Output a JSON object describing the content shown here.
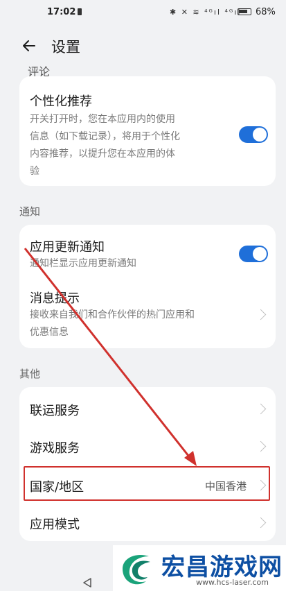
{
  "status": {
    "time": "17:02",
    "battery": "68%",
    "icons": "✱ ✕ ≋ ⁴ᴳıl ⁴ᴳıl"
  },
  "header": {
    "title": "设置"
  },
  "cut_label": "评论",
  "personalized": {
    "title": "个性化推荐",
    "desc": [
      "开关打开时，您在本应用内的使用",
      "信息（如下载记录），将用于个性化",
      "内容推荐，以提升您在本应用的体",
      "验"
    ],
    "on": true
  },
  "sections": {
    "notify": "通知",
    "other": "其他"
  },
  "notify_rows": [
    {
      "title": "应用更新通知",
      "desc": "通知栏显示应用更新通知",
      "on": true
    },
    {
      "title": "消息提示",
      "desc": [
        "接收来自我们和合作伙伴的热门应用和",
        "优惠信息"
      ]
    }
  ],
  "other_rows": [
    {
      "title": "联运服务"
    },
    {
      "title": "游戏服务"
    },
    {
      "title": "国家/地区",
      "value": "中国香港"
    },
    {
      "title": "应用模式"
    }
  ],
  "watermark": {
    "brand": "宏昌游戏网",
    "url": "www.hcs-laser.com"
  },
  "colors": {
    "accent": "#1f6fd9",
    "annotation": "#d0312d",
    "brand": "#0d4fa3"
  }
}
